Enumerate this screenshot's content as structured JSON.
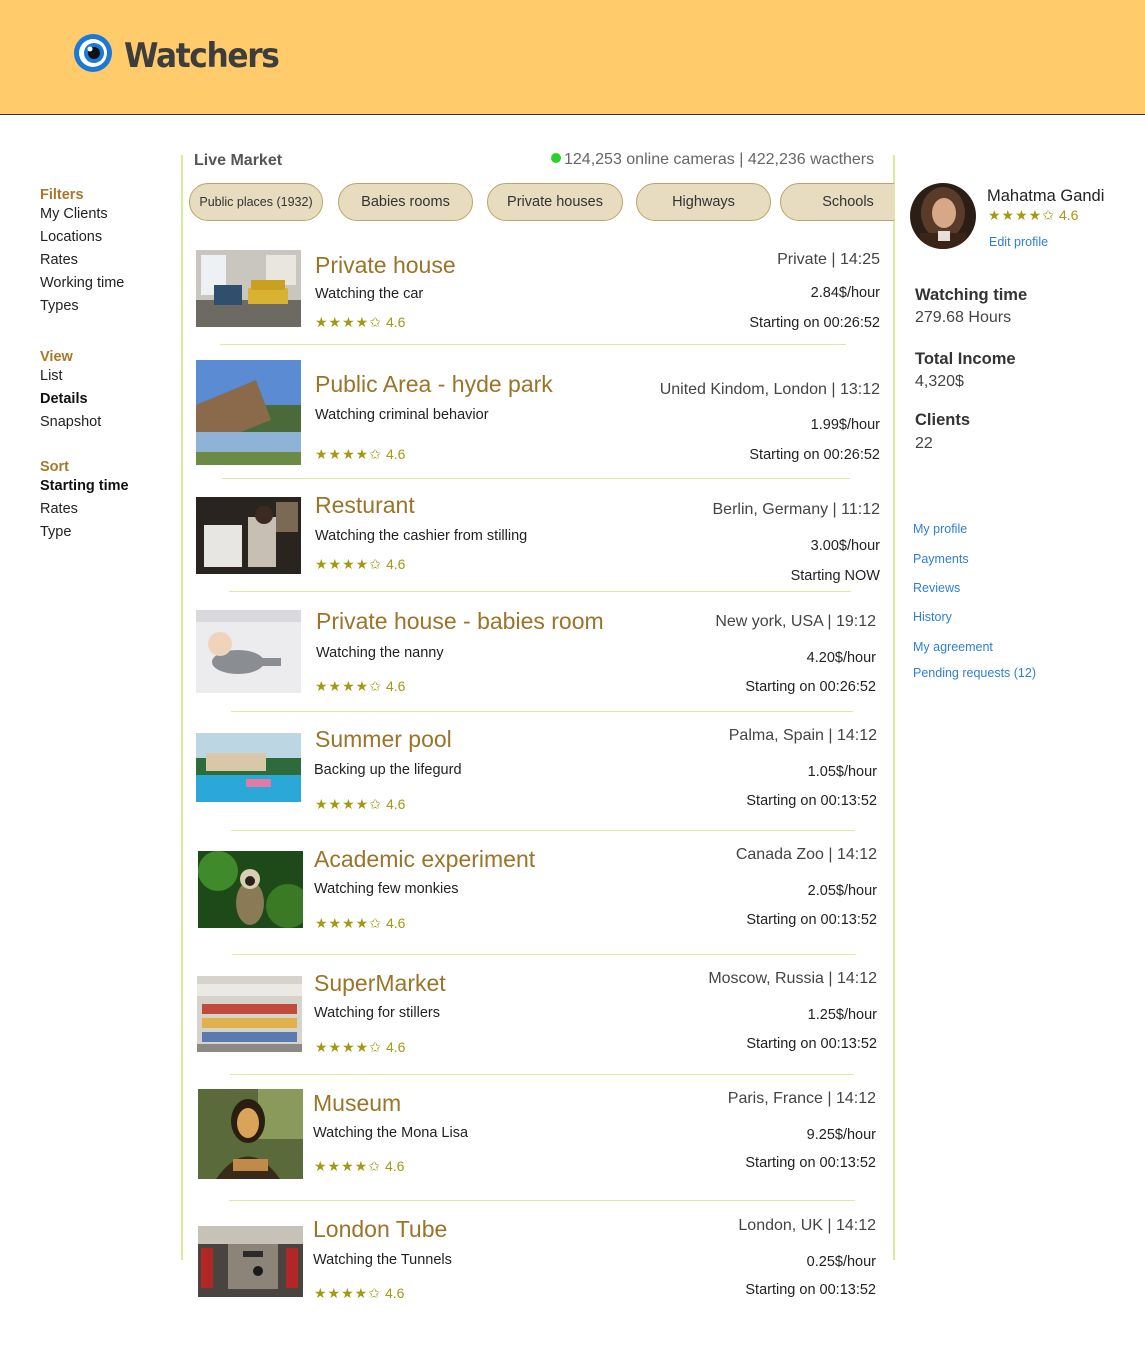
{
  "app": {
    "name": "Watchers"
  },
  "sidebar": {
    "filters": {
      "heading": "Filters",
      "items": [
        "My Clients",
        "Locations",
        "Rates",
        "Working time",
        "Types"
      ]
    },
    "view": {
      "heading": "View",
      "items": [
        "List",
        "Details",
        "Snapshot"
      ],
      "active": "Details"
    },
    "sort": {
      "heading": "Sort",
      "items": [
        "Starting time",
        "Rates",
        "Type"
      ],
      "active": "Starting time"
    }
  },
  "market": {
    "title": "Live Market",
    "online_text": "124,253 online cameras | 422,236 wacthers",
    "tabs": [
      "Public places (1932)",
      "Babies rooms",
      "Private houses",
      "Highways",
      "Schools"
    ]
  },
  "listings": [
    {
      "title": "Private house",
      "subtitle": "Watching the car",
      "stars": "★★★★✩",
      "rating": "4.6",
      "location": "Private | 14:25",
      "price": "2.84$/hour",
      "start": "Starting on 00:26:52",
      "thumb": "living-room"
    },
    {
      "title": "Public Area - hyde park",
      "subtitle": "Watching criminal behavior",
      "stars": "★★★★✩",
      "rating": "4.6",
      "location": "United Kindom, London | 13:12",
      "price": "1.99$/hour",
      "start": "Starting on 00:26:52",
      "thumb": "park"
    },
    {
      "title": "Resturant",
      "subtitle": "Watching the cashier from stilling",
      "stars": "★★★★✩",
      "rating": "4.6",
      "location": "Berlin, Germany | 11:12",
      "price": "3.00$/hour",
      "start": "Starting NOW",
      "thumb": "restaurant"
    },
    {
      "title": "Private house - babies room",
      "subtitle": "Watching the nanny",
      "stars": "★★★★✩",
      "rating": "4.6",
      "location": "New york, USA | 19:12",
      "price": "4.20$/hour",
      "start": "Starting on 00:26:52",
      "thumb": "baby"
    },
    {
      "title": "Summer pool",
      "subtitle": "Backing up the lifegurd",
      "stars": "★★★★✩",
      "rating": "4.6",
      "location": "Palma, Spain | 14:12",
      "price": "1.05$/hour",
      "start": "Starting on 00:13:52",
      "thumb": "pool"
    },
    {
      "title": "Academic experiment",
      "subtitle": "Watching few monkies",
      "stars": "★★★★✩",
      "rating": "4.6",
      "location": "Canada Zoo | 14:12",
      "price": "2.05$/hour",
      "start": "Starting on 00:13:52",
      "thumb": "monkey"
    },
    {
      "title": "SuperMarket",
      "subtitle": "Watching for stillers",
      "stars": "★★★★✩",
      "rating": "4.6",
      "location": "Moscow, Russia | 14:12",
      "price": "1.25$/hour",
      "start": "Starting on 00:13:52",
      "thumb": "market"
    },
    {
      "title": "Museum",
      "subtitle": "Watching the Mona Lisa",
      "stars": "★★★★✩",
      "rating": "4.6",
      "location": "Paris, France | 14:12",
      "price": "9.25$/hour",
      "start": "Starting on 00:13:52",
      "thumb": "mona-lisa"
    },
    {
      "title": "London Tube",
      "subtitle": "Watching the Tunnels",
      "stars": "★★★★✩",
      "rating": "4.6",
      "location": "London, UK | 14:12",
      "price": "0.25$/hour",
      "start": "Starting on 00:13:52",
      "thumb": "tube"
    }
  ],
  "profile": {
    "name": "Mahatma Gandi",
    "stars": "★★★★✩",
    "rating": "4.6",
    "edit_label": "Edit profile",
    "stats": [
      {
        "label": "Watching time",
        "value": "279.68 Hours"
      },
      {
        "label": "Total Income",
        "value": "4,320$"
      },
      {
        "label": "Clients",
        "value": "22"
      }
    ],
    "links": [
      "My profile",
      "Payments",
      "Reviews",
      "History",
      "My agreement",
      "Pending requests (12)"
    ]
  },
  "colors": {
    "header_bg": "#ffcb6b",
    "title_gold": "#9a7428",
    "star_olive": "#a19a12",
    "link_blue": "#2f7fd1",
    "divider_green": "#d9ec9a",
    "online_green": "#2ad12a"
  }
}
